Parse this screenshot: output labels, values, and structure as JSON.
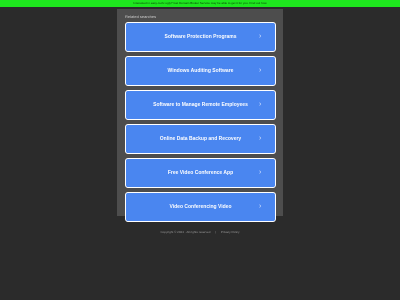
{
  "banner": {
    "text": "Interested in easy-to-fix ugly? Get Domain Broker Service may be able to get it for you. Find out how",
    "color": "#1ee61e"
  },
  "panel": {
    "heading": "Related searches"
  },
  "links": [
    {
      "label": "Software Protection Programs"
    },
    {
      "label": "Windows Auditing Software"
    },
    {
      "label": "Software to Manage Remote Employees"
    },
    {
      "label": "Online Data Backup and Recovery"
    },
    {
      "label": "Free Video Conference App"
    },
    {
      "label": "Video Conferencing Video"
    }
  ],
  "icons": {
    "chevron": "chevron-right-icon"
  },
  "footer": {
    "copyright": "Copyright © 2024 · All rights reserved",
    "separator": "|",
    "privacy": "Privacy Policy"
  },
  "colors": {
    "background": "#2b2b2b",
    "panel": "#4d4d4d",
    "button": "#4a86f0"
  }
}
